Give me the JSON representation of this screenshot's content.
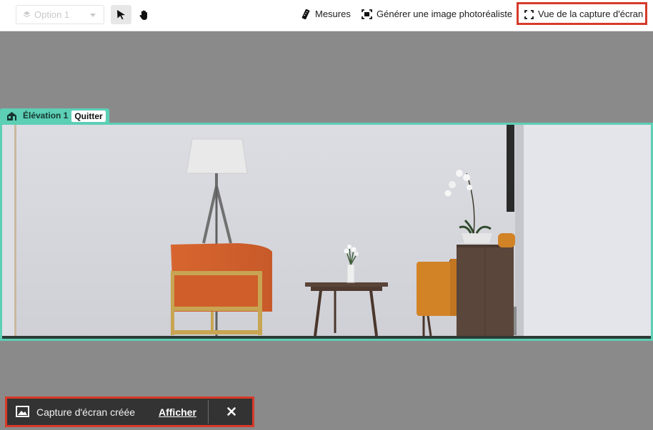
{
  "toolbar": {
    "option_select": {
      "value": "Option 1",
      "icon": "layers-icon"
    },
    "select_tool": {
      "icon": "cursor-arrow-icon"
    },
    "pan_tool": {
      "icon": "hand-icon"
    },
    "measures": {
      "label": "Mesures",
      "icon": "ruler-icon"
    },
    "photoreal": {
      "label": "Générer une image photoréaliste",
      "icon": "camera-frame-icon"
    },
    "screenshot_view": {
      "label": "Vue de la capture d'écran",
      "icon": "fullscreen-corners-icon"
    }
  },
  "elevation": {
    "label": "Élévation 1",
    "quit_label": "Quitter",
    "icon": "house-icon"
  },
  "toast": {
    "message": "Capture d'écran créée",
    "action_label": "Afficher",
    "icon": "image-icon",
    "close_icon": "close-icon"
  },
  "colors": {
    "accent": "#5ccfb5",
    "highlight": "#d63a2a",
    "toast_bg": "#333333",
    "canvas_bg": "#8a8a8a"
  }
}
